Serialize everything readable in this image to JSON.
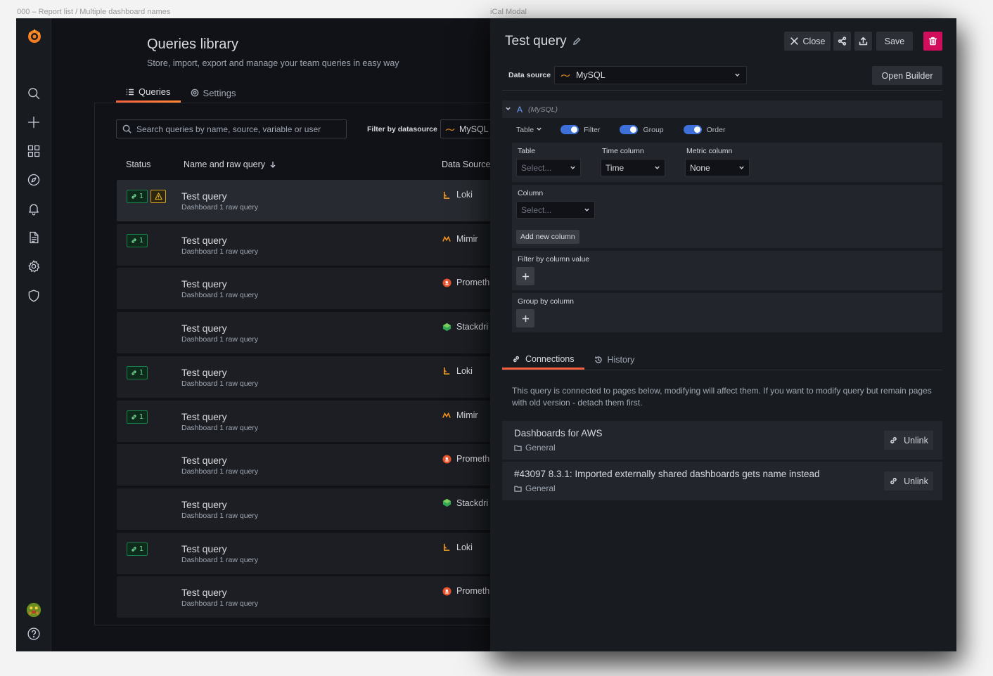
{
  "frame_labels": {
    "left": "000 – Report list / Multiple dashboard names",
    "right": "iCal Modal"
  },
  "library": {
    "title": "Queries library",
    "subtitle": "Store, import, export and manage your team queries in easy way",
    "tabs": [
      {
        "label": "Queries",
        "icon": "list-icon",
        "active": true
      },
      {
        "label": "Settings",
        "icon": "gear-icon",
        "active": false
      }
    ],
    "search_placeholder": "Search queries by name, source, variable or user",
    "filter_label": "Filter by datasource",
    "filter_value": "MySQL",
    "columns": {
      "status": "Status",
      "name": "Name and raw query",
      "datasource": "Data Source"
    },
    "rows": [
      {
        "title": "Test query",
        "sub": "Dashboard 1 raw query",
        "ds": "Loki",
        "ds_icon": "loki",
        "links": "1",
        "warn": true
      },
      {
        "title": "Test query",
        "sub": "Dashboard 1 raw query",
        "ds": "Mimir",
        "ds_icon": "mimir",
        "links": "1",
        "warn": false
      },
      {
        "title": "Test query",
        "sub": "Dashboard 1 raw query",
        "ds": "Prometh",
        "ds_icon": "prometheus",
        "links": "",
        "warn": false
      },
      {
        "title": "Test query",
        "sub": "Dashboard 1 raw query",
        "ds": "Stackdri",
        "ds_icon": "stackdriver",
        "links": "",
        "warn": false
      },
      {
        "title": "Test query",
        "sub": "Dashboard 1 raw query",
        "ds": "Loki",
        "ds_icon": "loki",
        "links": "1",
        "warn": false
      },
      {
        "title": "Test query",
        "sub": "Dashboard 1 raw query",
        "ds": "Mimir",
        "ds_icon": "mimir",
        "links": "1",
        "warn": false
      },
      {
        "title": "Test query",
        "sub": "Dashboard 1 raw query",
        "ds": "Prometh",
        "ds_icon": "prometheus",
        "links": "",
        "warn": false
      },
      {
        "title": "Test query",
        "sub": "Dashboard 1 raw query",
        "ds": "Stackdri",
        "ds_icon": "stackdriver",
        "links": "",
        "warn": false
      },
      {
        "title": "Test query",
        "sub": "Dashboard 1 raw query",
        "ds": "Loki",
        "ds_icon": "loki",
        "links": "1",
        "warn": false
      },
      {
        "title": "Test query",
        "sub": "Dashboard 1 raw query",
        "ds": "Prometh",
        "ds_icon": "prometheus",
        "links": "",
        "warn": false
      }
    ]
  },
  "drawer": {
    "title": "Test query",
    "buttons": {
      "close": "Close",
      "save": "Save",
      "open_builder": "Open Builder"
    },
    "datasource_label": "Data source",
    "datasource_value": "MySQL",
    "query": {
      "letter": "A",
      "source": "(MySQL)",
      "mode": "Table",
      "toggles": [
        {
          "label": "Filter",
          "on": true
        },
        {
          "label": "Group",
          "on": true
        },
        {
          "label": "Order",
          "on": true
        }
      ],
      "table_label": "Table",
      "table_placeholder": "Select...",
      "time_column_label": "Time column",
      "time_column_value": "Time",
      "metric_column_label": "Metric column",
      "metric_column_value": "None",
      "column_label": "Column",
      "column_placeholder": "Select...",
      "add_column": "Add new column",
      "filter_by_label": "Filter by column value",
      "group_by_label": "Group by column"
    },
    "tabs": [
      {
        "label": "Connections",
        "active": true
      },
      {
        "label": "History",
        "active": false
      }
    ],
    "connections_text": "This query is connected to pages below, modifying will affect them. If you want to modify query but remain pages with old version - detach them first.",
    "connections": [
      {
        "name": "Dashboards for AWS",
        "folder": "General",
        "action": "Unlink"
      },
      {
        "name": "#43097 8.3.1: Imported externally shared dashboards gets name instead",
        "folder": "General",
        "action": "Unlink"
      }
    ]
  },
  "colors": {
    "accent": "#f55f3e",
    "switch": "#3d71d9",
    "danger": "#d10e5c",
    "link_badge": "#6ccf8e",
    "warn": "#d0a320"
  }
}
